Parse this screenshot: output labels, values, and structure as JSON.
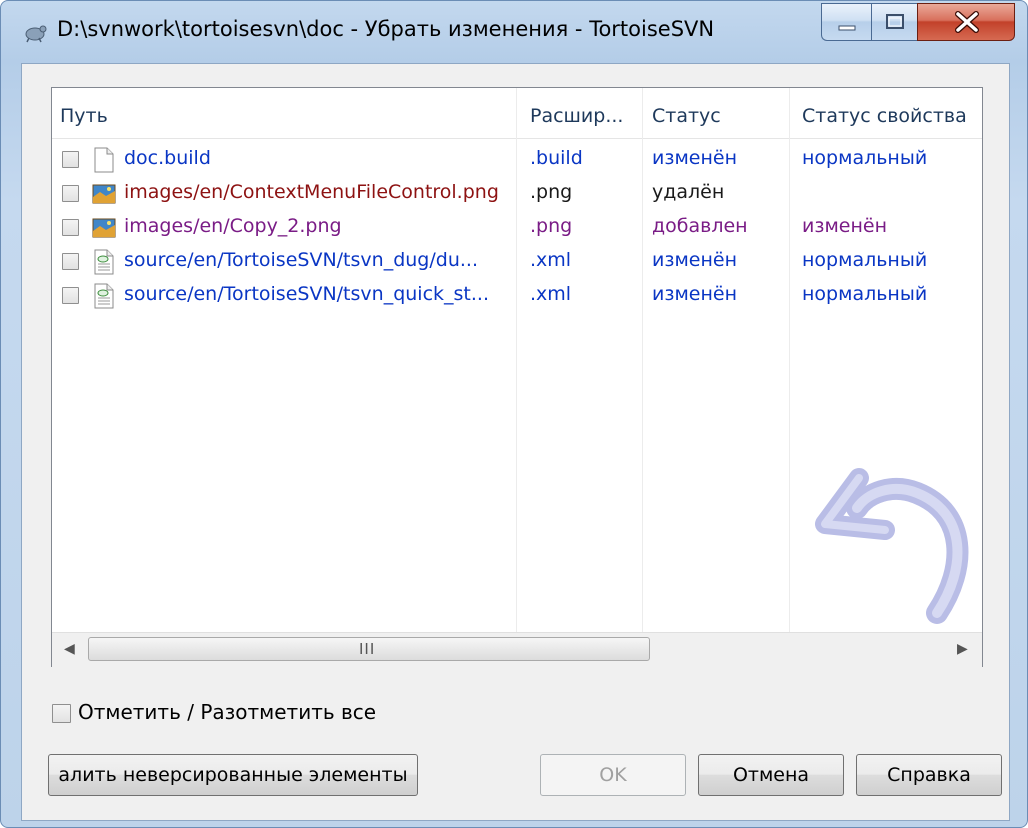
{
  "window": {
    "title": "D:\\svnwork\\tortoisesvn\\doc - Убрать изменения - TortoiseSVN",
    "caption_icons": [
      "minimize-icon",
      "maximize-icon",
      "close-icon"
    ]
  },
  "list": {
    "columns": [
      "Путь",
      "Расшир...",
      "Статус",
      "Статус свойства"
    ],
    "rows": [
      {
        "path": "doc.build",
        "ext": ".build",
        "status": "изменён",
        "prop_status": "нормальный",
        "icon": "document-icon",
        "color": "blue"
      },
      {
        "path": "images/en/ContextMenuFileControl.png",
        "ext": ".png",
        "status": "удалён",
        "prop_status": "",
        "icon": "image-icon",
        "color": "maroon"
      },
      {
        "path": "images/en/Copy_2.png",
        "ext": ".png",
        "status": "добавлен",
        "prop_status": "изменён",
        "icon": "image-icon",
        "color": "purple"
      },
      {
        "path": "source/en/TortoiseSVN/tsvn_dug/du...",
        "ext": ".xml",
        "status": "изменён",
        "prop_status": "нормальный",
        "icon": "xml-file-icon",
        "color": "blue"
      },
      {
        "path": "source/en/TortoiseSVN/tsvn_quick_st...",
        "ext": ".xml",
        "status": "изменён",
        "prop_status": "нормальный",
        "icon": "xml-file-icon",
        "color": "blue"
      }
    ],
    "scroll_grip": "III"
  },
  "select_all": {
    "label": "Отметить / Разотметить все"
  },
  "buttons": {
    "delete_unversioned": "алить неверсированные элементы",
    "ok": "OK",
    "cancel": "Отмена",
    "help": "Справка"
  },
  "colors": {
    "blue": "#0a36c4",
    "purple": "#7a1c86",
    "maroon": "#8d1212"
  }
}
